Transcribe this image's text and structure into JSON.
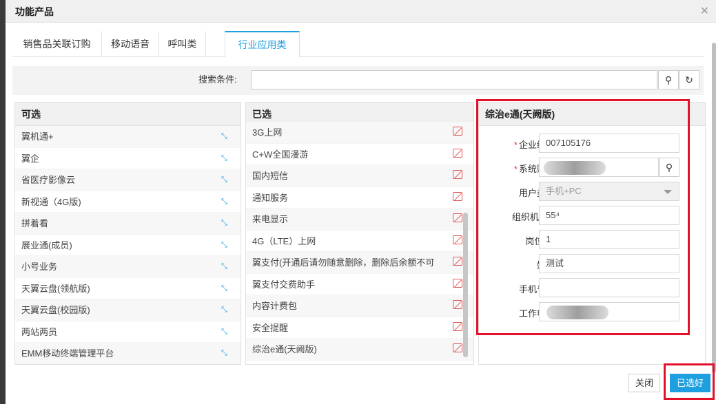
{
  "dialog": {
    "title": "功能产品"
  },
  "tabs": [
    {
      "label": "销售品关联订购",
      "active": false
    },
    {
      "label": "移动语音",
      "active": false
    },
    {
      "label": "呼叫类",
      "active": false
    },
    {
      "label": "行业应用类",
      "active": true
    }
  ],
  "search": {
    "label": "搜索条件:",
    "value": "",
    "placeholder": ""
  },
  "available": {
    "title": "可选",
    "items": [
      "翼机通+",
      "翼企",
      "省医疗影像云",
      "新视通（4G版)",
      "拼着看",
      "展业通(成员)",
      "小号业务",
      "天翼云盘(领航版)",
      "天翼云盘(校园版)",
      "两站两员",
      "EMM移动终端管理平台"
    ]
  },
  "selected": {
    "title": "已选",
    "items": [
      "3G上网",
      "C+W全国漫游",
      "国内短信",
      "通知服务",
      "来电显示",
      "4G（LTE）上网",
      "翼支付(开通后请勿随意删除，删除后余额不可",
      "翼支付交费助手",
      "内容计费包",
      "安全提醒",
      "综治e通(天阙版)"
    ]
  },
  "form": {
    "title": "综治e通(天阙版)",
    "enterprise_no": {
      "label": "企业编号",
      "value": "007105176",
      "required": true
    },
    "system_account": {
      "label": "系统账号",
      "value": "",
      "required": true
    },
    "user_type": {
      "label": "用户类型",
      "value": "手机+PC"
    },
    "org_id": {
      "label": "组织机构id",
      "value": "55⁴"
    },
    "post_ids": {
      "label": "岗位ids",
      "value": "1"
    },
    "name": {
      "label": "姓名",
      "value": "测试"
    },
    "mobile": {
      "label": "手机号码",
      "value": ""
    },
    "work_phone": {
      "label": "工作电话",
      "value": ""
    }
  },
  "footer": {
    "close_label": "关闭",
    "confirm_label": "已选好"
  },
  "colors": {
    "accent": "#1e9fdf",
    "highlight": "#e3102a",
    "required": "#e33333"
  }
}
